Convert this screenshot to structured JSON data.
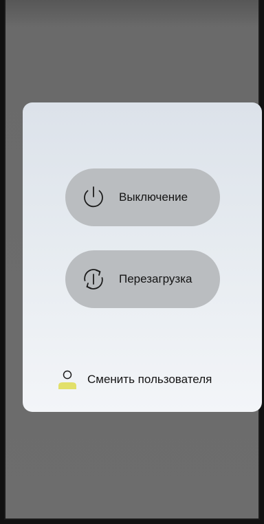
{
  "power_menu": {
    "shutdown": {
      "label": "Выключение",
      "icon": "power-icon"
    },
    "restart": {
      "label": "Перезагрузка",
      "icon": "restart-icon"
    },
    "switch_user": {
      "label": "Сменить пользователя",
      "icon": "user-icon"
    }
  },
  "colors": {
    "backdrop": "#6d6d6d",
    "dialog_top": "#dce2ea",
    "dialog_bottom": "#f3f5f8",
    "pill": "#babdc0",
    "user_icon_accent": "#e2e06a",
    "text": "#141414"
  }
}
